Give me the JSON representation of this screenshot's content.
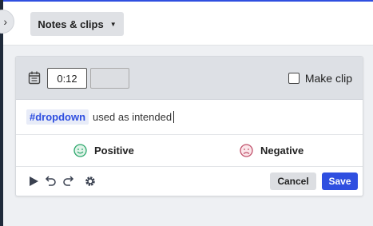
{
  "header": {
    "notes_button_label": "Notes & clips"
  },
  "clip_editor": {
    "start_time": "0:12",
    "end_time": "",
    "make_clip_label": "Make clip",
    "make_clip_checked": false
  },
  "note": {
    "tag": "#dropdown",
    "text": "used as intended"
  },
  "sentiment": {
    "positive_label": "Positive",
    "negative_label": "Negative"
  },
  "toolbar": {
    "cancel_label": "Cancel",
    "save_label": "Save"
  },
  "colors": {
    "accent": "#2f4fe0",
    "positive_face": "#2aa66a",
    "negative_face": "#c0506a"
  }
}
